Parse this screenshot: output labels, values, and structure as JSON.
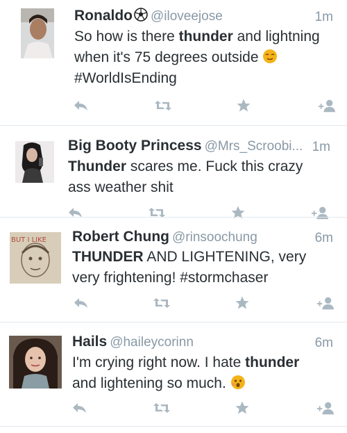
{
  "tweets": [
    {
      "name": "Ronaldo",
      "handle": "@iloveejose",
      "time": "1m",
      "lines": [
        {
          "pre": "So how is there ",
          "bold": "thunder",
          "post": " and lightning"
        },
        {
          "pre": "when it's 75 degrees outside ",
          "bold": "",
          "post": ""
        },
        {
          "pre": "#WorldIsEnding",
          "bold": "",
          "post": ""
        }
      ],
      "name_icon": "soccer-ball-icon",
      "emoji": "smiling-face-icon"
    },
    {
      "name": "Big Booty Princess",
      "handle": "@Mrs_Scroobi...",
      "time": "1m",
      "lines": [
        {
          "pre": "",
          "bold": "Thunder",
          "post": " scares me. Fuck this crazy"
        },
        {
          "pre": "ass weather shit",
          "bold": "",
          "post": ""
        }
      ]
    },
    {
      "name": "Robert Chung",
      "handle": "@rinsoochung",
      "time": "6m",
      "lines": [
        {
          "pre": "",
          "bold": "THUNDER",
          "post": " AND LIGHTENING, very"
        },
        {
          "pre": "very frightening! #stormchaser",
          "bold": "",
          "post": ""
        }
      ],
      "avatar_text": "BUT I LIKE"
    },
    {
      "name": "Hails",
      "handle": "@haileycorinn",
      "time": "6m",
      "lines": [
        {
          "pre": "I'm crying right now. I hate ",
          "bold": "thunder",
          "post": ""
        },
        {
          "pre": "and lightening so much. ",
          "bold": "",
          "post": ""
        }
      ],
      "emoji": "scared-face-icon"
    }
  ],
  "actions": [
    "reply-icon",
    "retweet-icon",
    "favorite-icon",
    "follow-icon"
  ],
  "colors": {
    "icon": "#aab8c2",
    "text": "#292f33",
    "secondary": "#8899a6",
    "divider": "#e1e8ed",
    "emoji": "#f5b31a"
  }
}
